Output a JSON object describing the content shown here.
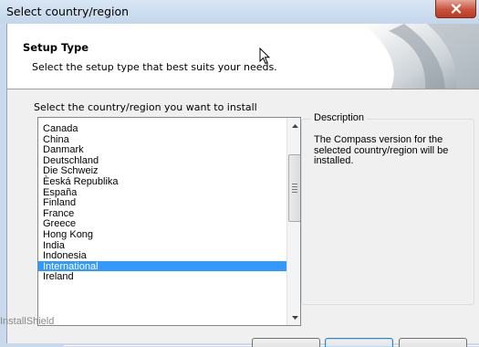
{
  "window": {
    "title": "Select country/region",
    "close_symbol": "✕"
  },
  "header": {
    "title": "Setup Type",
    "subtitle": "Select the setup type that best suits your needs."
  },
  "prompt": "Select the country/region you want to install",
  "countries": {
    "items": [
      "Canada",
      "China",
      "Danmark",
      "Deutschland",
      "Die Schweiz",
      "Èeská Republika",
      "España",
      "Finland",
      "France",
      "Greece",
      "Hong Kong",
      "India",
      "Indonesia",
      "International",
      "Ireland"
    ],
    "selected": "International"
  },
  "description": {
    "label": "Description",
    "text": "The Compass version for the selected country/region will  be installed."
  },
  "footer": {
    "brand": "InstallShield"
  },
  "icons": {
    "close": "close-icon",
    "cursor": "mouse-pointer-icon",
    "scroll_up": "arrow-up-icon",
    "scroll_down": "arrow-down-icon",
    "thumb_grip": "grip-icon"
  },
  "colors": {
    "selection": "#3399ff",
    "close_button": "#c8533c",
    "title_bar": "#c9d8ea"
  }
}
